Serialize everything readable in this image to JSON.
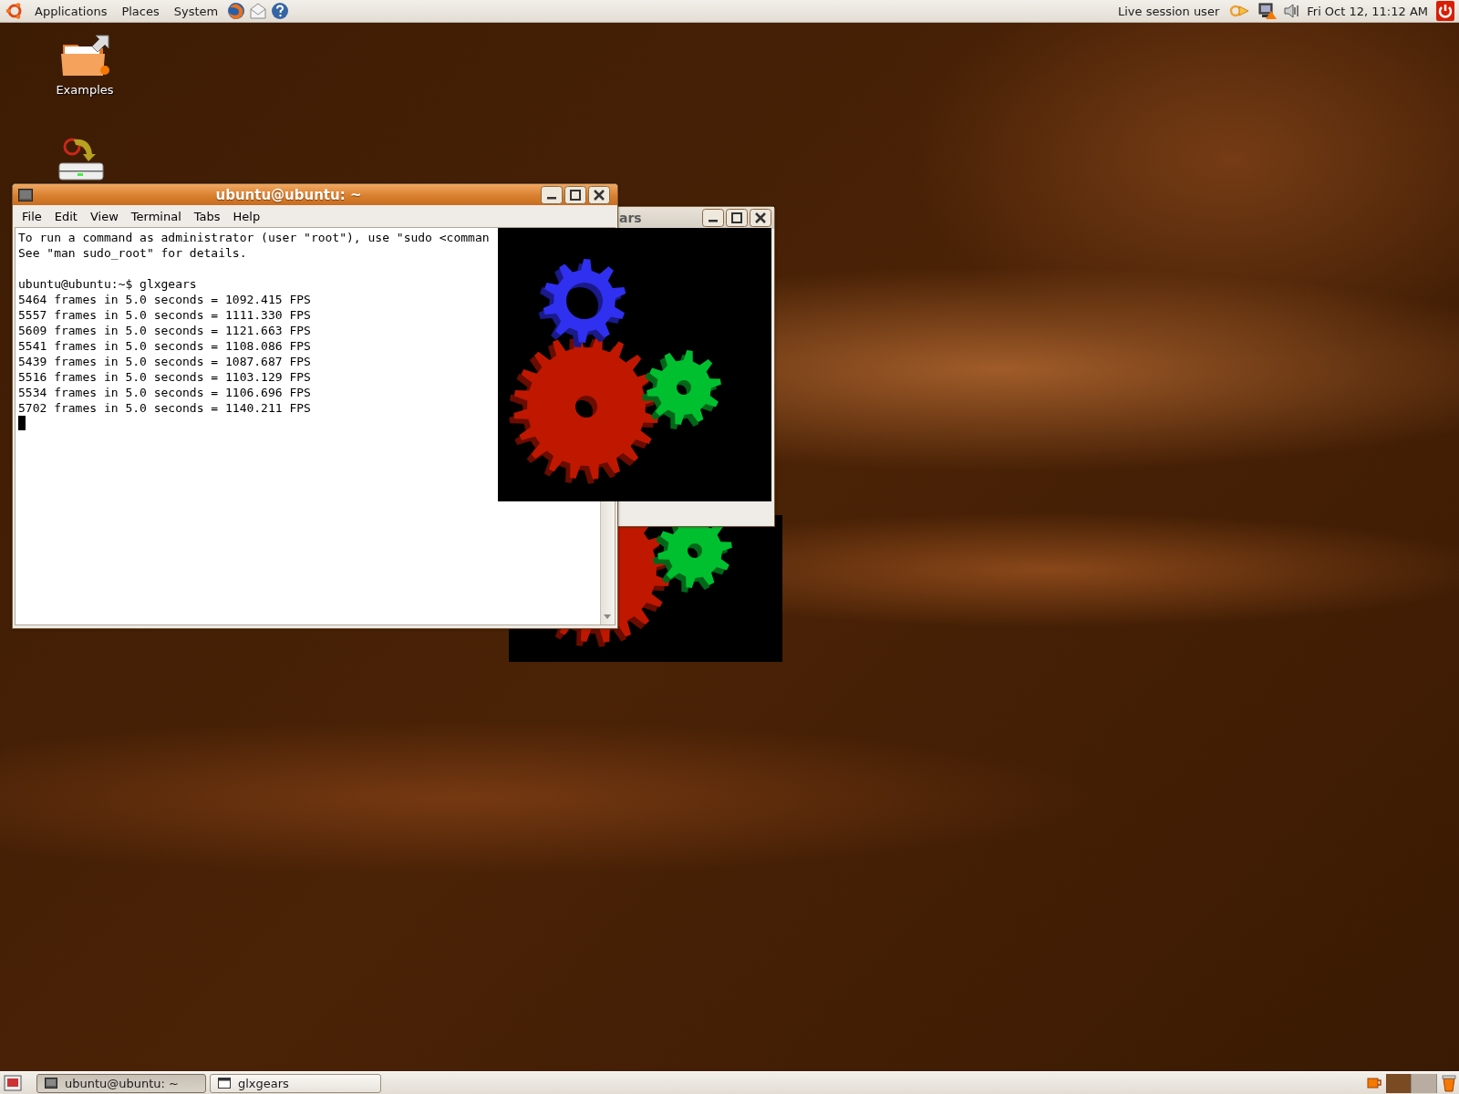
{
  "top_panel": {
    "menus": [
      {
        "label": "Applications"
      },
      {
        "label": "Places"
      },
      {
        "label": "System"
      }
    ],
    "user": "Live session user",
    "clock": "Fri Oct 12, 11:12 AM"
  },
  "desktop_icons": [
    {
      "kind": "folder",
      "label": "Examples"
    },
    {
      "kind": "installer"
    }
  ],
  "terminal_window": {
    "title": "ubuntu@ubuntu: ~",
    "menu": [
      "File",
      "Edit",
      "View",
      "Terminal",
      "Tabs",
      "Help"
    ],
    "blocks": [
      [
        "To run a command as administrator (user \"root\"), use \"sudo <comman",
        "See \"man sudo_root\" for details."
      ],
      [
        "ubuntu@ubuntu:~$ glxgears",
        "5464 frames in 5.0 seconds = 1092.415 FPS",
        "5557 frames in 5.0 seconds = 1111.330 FPS",
        "5609 frames in 5.0 seconds = 1121.663 FPS",
        "5541 frames in 5.0 seconds = 1108.086 FPS",
        "5439 frames in 5.0 seconds = 1087.687 FPS",
        "5516 frames in 5.0 seconds = 1103.129 FPS",
        "5534 frames in 5.0 seconds = 1106.696 FPS",
        "5702 frames in 5.0 seconds = 1140.211 FPS"
      ]
    ]
  },
  "glxgears_window": {
    "title": "ars"
  },
  "bottom_panel": {
    "tasks": [
      {
        "kind": "terminal",
        "label": "ubuntu@ubuntu: ~",
        "selected": true
      },
      {
        "kind": "window",
        "label": "glxgears",
        "selected": false
      }
    ],
    "workspaces": [
      {
        "selected": true
      },
      {
        "selected": false
      }
    ]
  }
}
